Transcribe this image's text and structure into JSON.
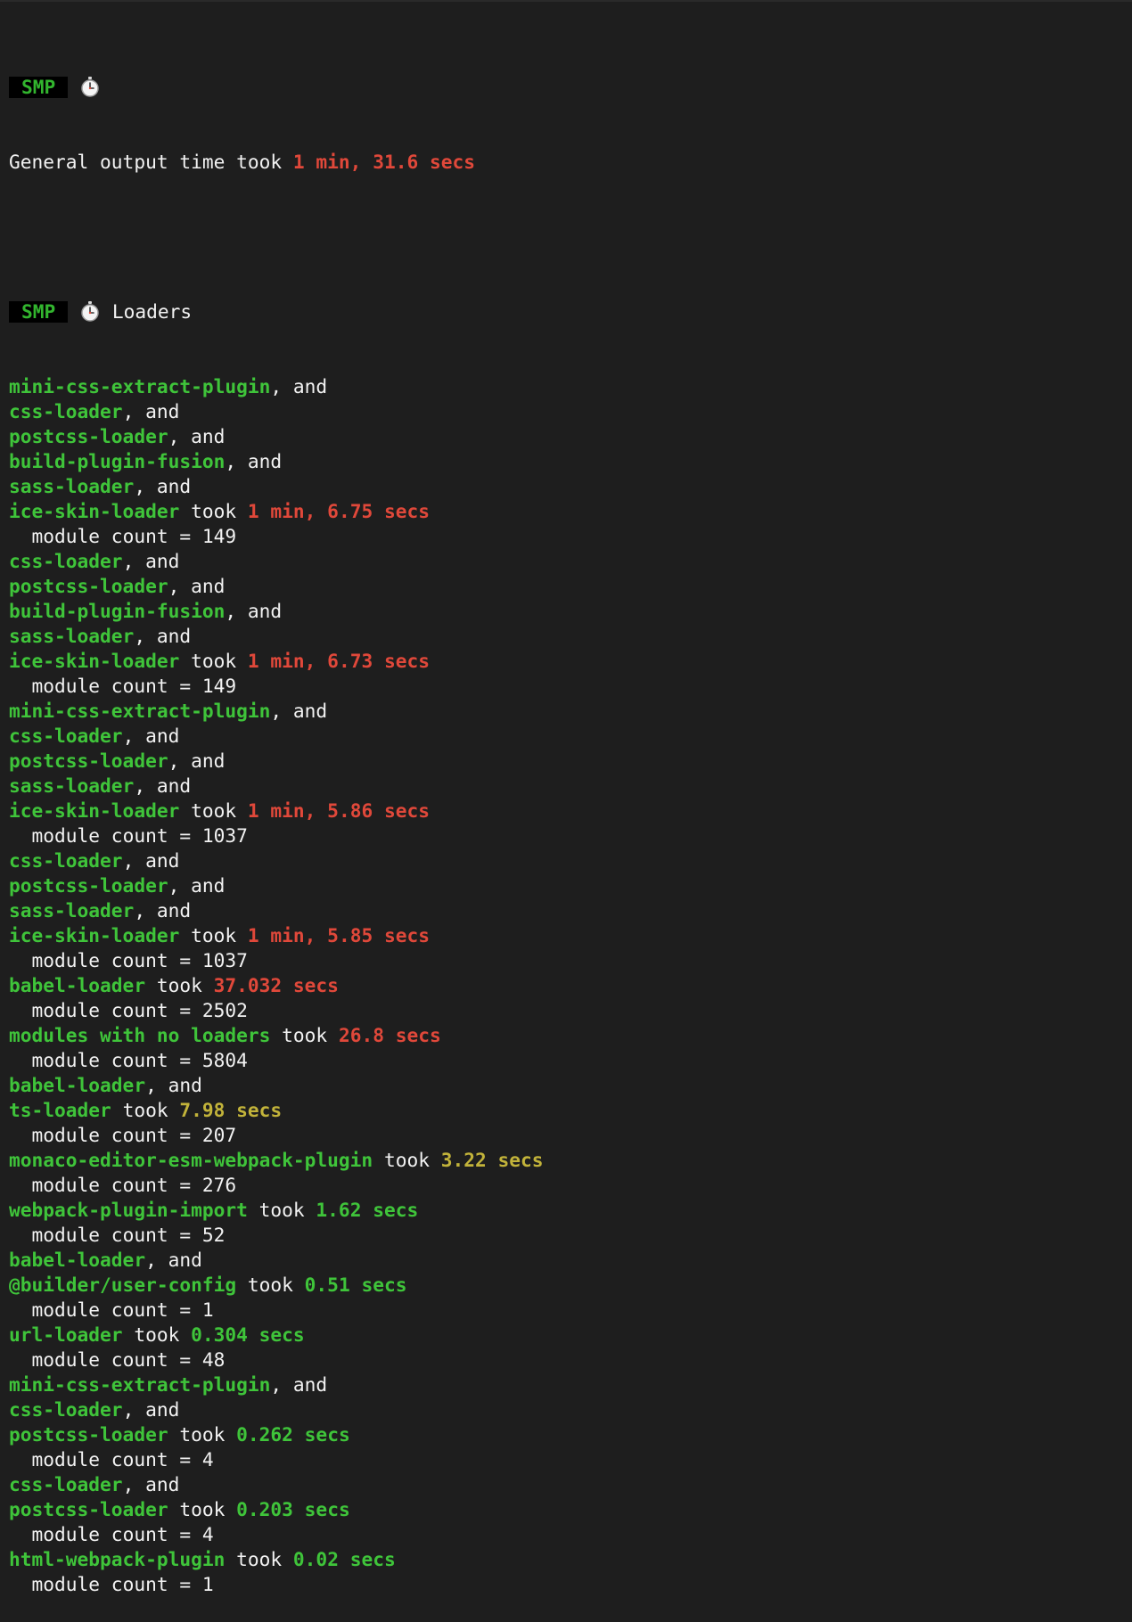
{
  "header": {
    "badge": "SMP",
    "icon": "stopwatch-icon",
    "general_label": "General output time took ",
    "general_time": "1 min, 31.6 secs",
    "loaders_title": "Loaders"
  },
  "words": {
    "and": ", and",
    "took": " took ",
    "indent": "  "
  },
  "colors": {
    "background": "#1e1e1e",
    "loader_green": "#3fc43a",
    "time_red": "#e0483a",
    "time_yellow": "#c2b33a",
    "time_green": "#3fc43a"
  },
  "lines": [
    {
      "kind": "and",
      "name": "mini-css-extract-plugin"
    },
    {
      "kind": "and",
      "name": "css-loader"
    },
    {
      "kind": "and",
      "name": "postcss-loader"
    },
    {
      "kind": "and",
      "name": "build-plugin-fusion"
    },
    {
      "kind": "and",
      "name": "sass-loader"
    },
    {
      "kind": "took",
      "name": "ice-skin-loader",
      "time": "1 min, 6.75 secs",
      "level": "red"
    },
    {
      "kind": "count",
      "text": "module count = 149"
    },
    {
      "kind": "and",
      "name": "css-loader"
    },
    {
      "kind": "and",
      "name": "postcss-loader"
    },
    {
      "kind": "and",
      "name": "build-plugin-fusion"
    },
    {
      "kind": "and",
      "name": "sass-loader"
    },
    {
      "kind": "took",
      "name": "ice-skin-loader",
      "time": "1 min, 6.73 secs",
      "level": "red"
    },
    {
      "kind": "count",
      "text": "module count = 149"
    },
    {
      "kind": "and",
      "name": "mini-css-extract-plugin"
    },
    {
      "kind": "and",
      "name": "css-loader"
    },
    {
      "kind": "and",
      "name": "postcss-loader"
    },
    {
      "kind": "and",
      "name": "sass-loader"
    },
    {
      "kind": "took",
      "name": "ice-skin-loader",
      "time": "1 min, 5.86 secs",
      "level": "red"
    },
    {
      "kind": "count",
      "text": "module count = 1037"
    },
    {
      "kind": "and",
      "name": "css-loader"
    },
    {
      "kind": "and",
      "name": "postcss-loader"
    },
    {
      "kind": "and",
      "name": "sass-loader"
    },
    {
      "kind": "took",
      "name": "ice-skin-loader",
      "time": "1 min, 5.85 secs",
      "level": "red"
    },
    {
      "kind": "count",
      "text": "module count = 1037"
    },
    {
      "kind": "took",
      "name": "babel-loader",
      "time": "37.032 secs",
      "level": "red"
    },
    {
      "kind": "count",
      "text": "module count = 2502"
    },
    {
      "kind": "took",
      "name": "modules with no loaders",
      "time": "26.8 secs",
      "level": "red"
    },
    {
      "kind": "count",
      "text": "module count = 5804"
    },
    {
      "kind": "and",
      "name": "babel-loader"
    },
    {
      "kind": "took",
      "name": "ts-loader",
      "time": "7.98 secs",
      "level": "yellow"
    },
    {
      "kind": "count",
      "text": "module count = 207"
    },
    {
      "kind": "took",
      "name": "monaco-editor-esm-webpack-plugin",
      "time": "3.22 secs",
      "level": "yellow"
    },
    {
      "kind": "count",
      "text": "module count = 276"
    },
    {
      "kind": "took",
      "name": "webpack-plugin-import",
      "time": "1.62 secs",
      "level": "green"
    },
    {
      "kind": "count",
      "text": "module count = 52"
    },
    {
      "kind": "and",
      "name": "babel-loader"
    },
    {
      "kind": "took",
      "name": "@builder/user-config",
      "time": "0.51 secs",
      "level": "green"
    },
    {
      "kind": "count",
      "text": "module count = 1"
    },
    {
      "kind": "took",
      "name": "url-loader",
      "time": "0.304 secs",
      "level": "green"
    },
    {
      "kind": "count",
      "text": "module count = 48"
    },
    {
      "kind": "and",
      "name": "mini-css-extract-plugin"
    },
    {
      "kind": "and",
      "name": "css-loader"
    },
    {
      "kind": "took",
      "name": "postcss-loader",
      "time": "0.262 secs",
      "level": "green"
    },
    {
      "kind": "count",
      "text": "module count = 4"
    },
    {
      "kind": "and",
      "name": "css-loader"
    },
    {
      "kind": "took",
      "name": "postcss-loader",
      "time": "0.203 secs",
      "level": "green"
    },
    {
      "kind": "count",
      "text": "module count = 4"
    },
    {
      "kind": "took",
      "name": "html-webpack-plugin",
      "time": "0.02 secs",
      "level": "green"
    },
    {
      "kind": "count",
      "text": "module count = 1"
    }
  ]
}
